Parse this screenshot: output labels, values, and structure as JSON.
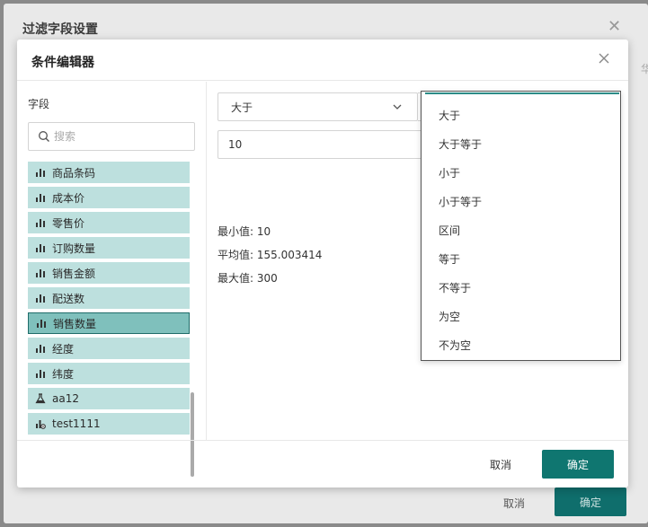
{
  "background_dialog": {
    "title": "过滤字段设置",
    "side_text": "华",
    "cancel_label": "取消",
    "ok_label": "确定"
  },
  "modal": {
    "title": "条件编辑器",
    "fields_label": "字段",
    "search_placeholder": "搜索",
    "fields": [
      {
        "label": "商品条码",
        "icon": "bar-chart-icon"
      },
      {
        "label": "成本价",
        "icon": "bar-chart-icon"
      },
      {
        "label": "零售价",
        "icon": "bar-chart-icon"
      },
      {
        "label": "订购数量",
        "icon": "bar-chart-icon"
      },
      {
        "label": "销售金额",
        "icon": "bar-chart-icon"
      },
      {
        "label": "配送数",
        "icon": "bar-chart-icon"
      },
      {
        "label": "销售数量",
        "icon": "bar-chart-icon",
        "selected": true
      },
      {
        "label": "经度",
        "icon": "bar-chart-icon"
      },
      {
        "label": "纬度",
        "icon": "bar-chart-icon"
      },
      {
        "label": "aa12",
        "icon": "flask-icon"
      },
      {
        "label": "test1111",
        "icon": "bar-chart-gear-icon"
      }
    ],
    "condition_selected": "大于",
    "value": "10",
    "stats": {
      "min": "最小值: 10",
      "avg": "平均值: 155.003414",
      "max": "最大值: 300"
    },
    "cancel_label": "取消",
    "ok_label": "确定"
  },
  "dropdown_options": [
    "大于",
    "大于等于",
    "小于",
    "小于等于",
    "区间",
    "等于",
    "不等于",
    "为空",
    "不为空"
  ],
  "colors": {
    "accent": "#0f7670",
    "field_bg": "#bde0de",
    "field_selected_bg": "#7fc0bc"
  }
}
